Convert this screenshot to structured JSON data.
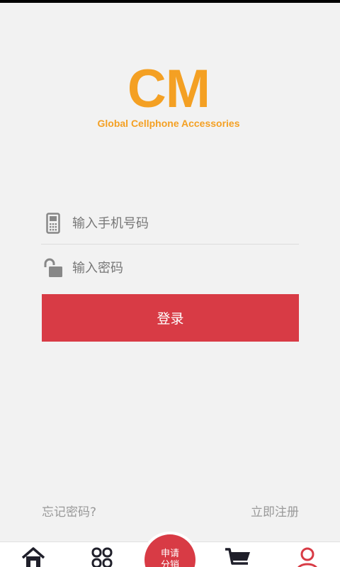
{
  "logo": {
    "mark": "CM",
    "tagline": "Global Cellphone Accessories"
  },
  "login": {
    "phone_placeholder": "输入手机号码",
    "password_placeholder": "输入密码",
    "phone_icon": "mobile-phone-icon",
    "password_icon": "unlock-icon",
    "submit_label": "登录"
  },
  "links": {
    "forgot_password": "忘记密码?",
    "register": "立即注册"
  },
  "tabbar": {
    "items": [
      {
        "icon": "home-icon"
      },
      {
        "icon": "category-icon"
      },
      {
        "line1": "申请",
        "line2": "分销"
      },
      {
        "icon": "cart-icon"
      },
      {
        "icon": "profile-icon"
      }
    ]
  },
  "colors": {
    "brand_orange": "#f4a023",
    "accent_red": "#d83b45",
    "background": "#f2f2f2",
    "icon_gray": "#888888",
    "tab_dark": "#1f1f2a"
  }
}
